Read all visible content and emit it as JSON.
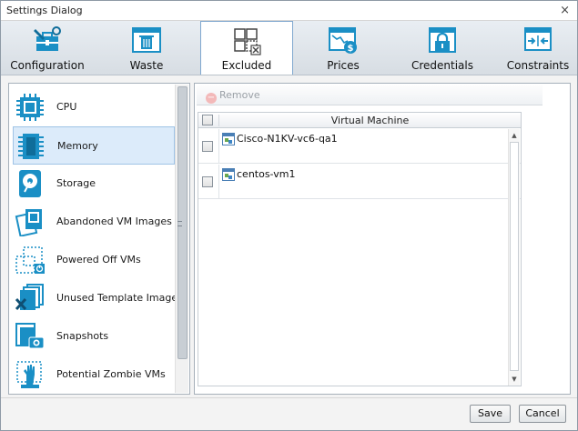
{
  "window": {
    "title": "Settings Dialog",
    "close_glyph": "×"
  },
  "tabs": [
    {
      "label": "Configuration",
      "icon": "configuration-icon",
      "selected": false
    },
    {
      "label": "Waste",
      "icon": "trash-window-icon",
      "selected": false
    },
    {
      "label": "Excluded",
      "icon": "excluded-grid-icon",
      "selected": true
    },
    {
      "label": "Prices",
      "icon": "prices-chart-icon",
      "selected": false
    },
    {
      "label": "Credentials",
      "icon": "lock-icon",
      "selected": false
    },
    {
      "label": "Constraints",
      "icon": "constraints-icon",
      "selected": false
    }
  ],
  "categories": [
    {
      "label": "CPU",
      "icon": "cpu-chip-icon",
      "selected": false
    },
    {
      "label": "Memory",
      "icon": "memory-module-icon",
      "selected": true
    },
    {
      "label": "Storage",
      "icon": "storage-disk-icon",
      "selected": false
    },
    {
      "label": "Abandoned VM Images",
      "icon": "abandoned-images-icon",
      "selected": false
    },
    {
      "label": "Powered Off VMs",
      "icon": "powered-off-icon",
      "selected": false
    },
    {
      "label": "Unused Template Images",
      "icon": "unused-template-icon",
      "selected": false
    },
    {
      "label": "Snapshots",
      "icon": "snapshot-camera-icon",
      "selected": false
    },
    {
      "label": "Potential Zombie VMs",
      "icon": "zombie-hand-icon",
      "selected": false
    }
  ],
  "toolbar": {
    "remove_label": "Remove",
    "remove_enabled": false
  },
  "grid": {
    "column_header": "Virtual Machine",
    "rows": [
      {
        "name": "Cisco-N1KV-vc6-qa1",
        "checked": false
      },
      {
        "name": "centos-vm1",
        "checked": false
      }
    ]
  },
  "footer": {
    "save_label": "Save",
    "cancel_label": "Cancel"
  },
  "colors": {
    "accent": "#1a8fc5",
    "selection": "#dcebfa",
    "toolbar_bg": "#dde3e9"
  }
}
